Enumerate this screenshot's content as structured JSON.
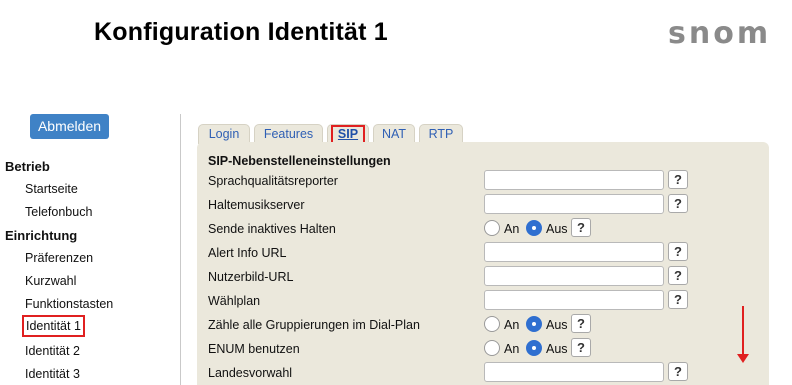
{
  "page": {
    "title": "Konfiguration Identität 1",
    "logo": "snom"
  },
  "sidebar": {
    "logout_label": "Abmelden",
    "sections": [
      {
        "heading": "Betrieb",
        "items": [
          "Startseite",
          "Telefonbuch"
        ]
      },
      {
        "heading": "Einrichtung",
        "items": [
          "Präferenzen",
          "Kurzwahl",
          "Funktionstasten",
          "Identität 1",
          "Identität 2",
          "Identität 3"
        ]
      }
    ],
    "active_item": "Identität 1"
  },
  "tabs": [
    {
      "label": "Login"
    },
    {
      "label": "Features"
    },
    {
      "label": "SIP"
    },
    {
      "label": "NAT"
    },
    {
      "label": "RTP"
    }
  ],
  "active_tab": "SIP",
  "section": {
    "title": "SIP-Nebenstelleneinstellungen"
  },
  "fields": [
    {
      "label": "Sprachqualitätsreporter",
      "type": "text",
      "value": ""
    },
    {
      "label": "Haltemusikserver",
      "type": "text",
      "value": ""
    },
    {
      "label": "Sende inaktives Halten",
      "type": "radio",
      "options": [
        "An",
        "Aus"
      ],
      "selected": "Aus"
    },
    {
      "label": "Alert Info URL",
      "type": "text",
      "value": ""
    },
    {
      "label": "Nutzerbild-URL",
      "type": "text",
      "value": ""
    },
    {
      "label": "Wählplan",
      "type": "text",
      "value": ""
    },
    {
      "label": "Zähle alle Gruppierungen im Dial-Plan",
      "type": "radio",
      "options": [
        "An",
        "Aus"
      ],
      "selected": "Aus"
    },
    {
      "label": "ENUM benutzen",
      "type": "radio",
      "options": [
        "An",
        "Aus"
      ],
      "selected": "Aus"
    },
    {
      "label": "Landesvorwahl",
      "type": "text",
      "value": ""
    }
  ],
  "help_label": "?",
  "colors": {
    "accent": "#3f82c6",
    "panel": "#ebe8dc",
    "tab_text": "#2f5fb4",
    "highlight": "#e02020"
  }
}
